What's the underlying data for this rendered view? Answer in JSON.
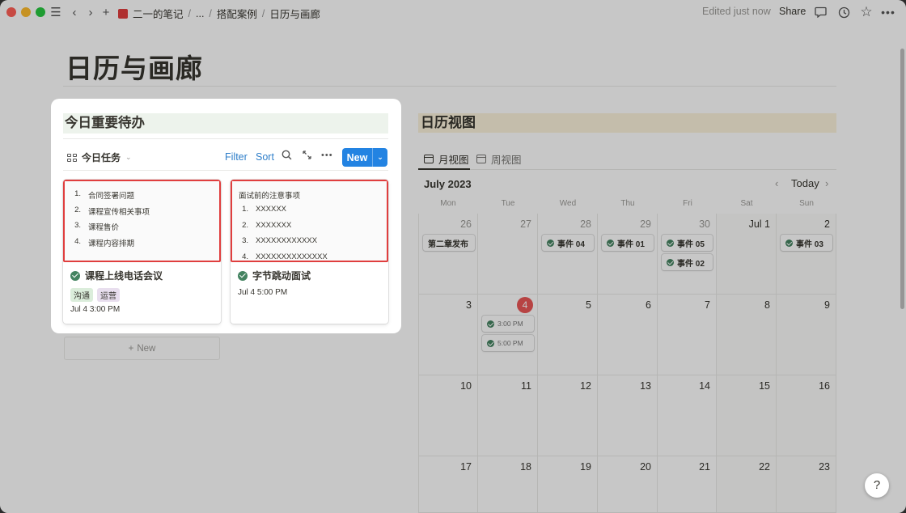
{
  "titlebar": {
    "breadcrumbs": [
      "二一的笔记",
      "...",
      "搭配案例",
      "日历与画廊"
    ],
    "edited": "Edited just now",
    "share_label": "Share"
  },
  "page": {
    "title": "日历与画廊"
  },
  "todo": {
    "heading": "今日重要待办",
    "view_name": "今日任务",
    "filter_label": "Filter",
    "sort_label": "Sort",
    "new_label": "New",
    "ghost_new_label": "New",
    "cards": [
      {
        "preview_title": "",
        "preview_items": [
          {
            "num": "1.",
            "text": "合同签署问题"
          },
          {
            "num": "2.",
            "text": "课程宣传相关事项"
          },
          {
            "num": "3.",
            "text": "课程售价"
          },
          {
            "num": "4.",
            "text": "课程内容排期"
          }
        ],
        "title": "课程上线电话会议",
        "tags": [
          {
            "label": "沟通",
            "color": "#dbeddb"
          },
          {
            "label": "运营",
            "color": "#e8deee"
          }
        ],
        "date": "Jul 4 3:00 PM"
      },
      {
        "preview_title": "面试前的注意事项",
        "preview_items": [
          {
            "num": "1.",
            "text": "XXXXXX"
          },
          {
            "num": "2.",
            "text": "XXXXXXX"
          },
          {
            "num": "3.",
            "text": "XXXXXXXXXXXX"
          },
          {
            "num": "4.",
            "text": "XXXXXXXXXXXXXX"
          }
        ],
        "title": "字节跳动面试",
        "tags": [],
        "date": "Jul 4 5:00 PM"
      }
    ]
  },
  "calendar": {
    "heading": "日历视图",
    "tabs": [
      "月视图",
      "周视图"
    ],
    "month": "July 2023",
    "today_label": "Today",
    "weekdays": [
      "Mon",
      "Tue",
      "Wed",
      "Thu",
      "Fri",
      "Sat",
      "Sun"
    ],
    "weeks": [
      [
        "26",
        "27",
        "28",
        "29",
        "30",
        "Jul 1",
        "2"
      ],
      [
        "3",
        "4",
        "5",
        "6",
        "7",
        "8",
        "9"
      ],
      [
        "10",
        "11",
        "12",
        "13",
        "14",
        "15",
        "16"
      ],
      [
        "17",
        "18",
        "19",
        "20",
        "21",
        "22",
        "23"
      ]
    ],
    "events": {
      "w0_mon": "第二章发布",
      "w0_wed": "事件 04",
      "w0_thu": "事件 01",
      "w0_fri_1": "事件 05",
      "w0_fri_2": "事件 02",
      "w0_sun": "事件 03",
      "w1_tue_1": "3:00 PM",
      "w1_tue_2": "5:00 PM"
    }
  },
  "colors": {
    "accent": "#2383e2",
    "highlight_border": "#e03e3e",
    "today": "#eb5757",
    "done_green": "#448361"
  }
}
